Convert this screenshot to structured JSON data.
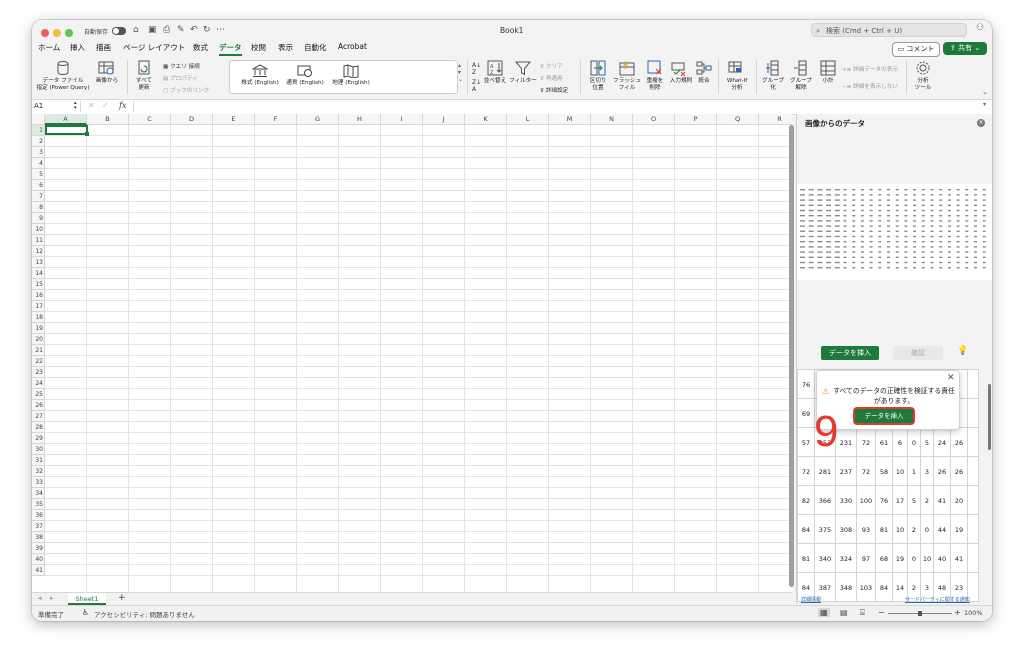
{
  "window": {
    "title": "Book1",
    "autosave_label": "自動保存",
    "search_placeholder": "検索 (Cmd + Ctrl + U)"
  },
  "tabs": [
    "ホーム",
    "挿入",
    "描画",
    "ページ レイアウト",
    "数式",
    "データ",
    "校閲",
    "表示",
    "自動化",
    "Acrobat"
  ],
  "active_tab": "データ",
  "top_right": {
    "comment": "コメント",
    "share": "共有"
  },
  "ribbon": {
    "get_data": "データ ファイル\n指定 (Power Query)",
    "from_picture": "画像から",
    "refresh_all": "すべて\n更新",
    "queries": "クエリ",
    "connections": "接続",
    "properties": "プロパティ",
    "workbook_links": "ブックのリンク",
    "stocks": "株式 (English)",
    "currencies": "通貨 (English)",
    "geography": "地理 (English)",
    "sort": "並べ替え",
    "filter": "フィルター",
    "clear": "クリア",
    "reapply": "再適用",
    "advanced": "詳細設定",
    "text_to_columns": "区切り\n位置",
    "flash_fill": "フラッシュ\nフィル",
    "remove_duplicates": "重複を\n削除",
    "data_validation": "入力規則",
    "consolidate": "統合",
    "what_if": "What-If\n分析",
    "group": "グループ\n化",
    "ungroup": "グループ\n解除",
    "subtotal": "小計",
    "show_detail": "詳細データの表示",
    "hide_detail": "詳細を表示しない",
    "analyze": "分析\nツール"
  },
  "formula_bar": {
    "name_box": "A1",
    "fx": "fx",
    "value": ""
  },
  "grid": {
    "columns": [
      "A",
      "B",
      "C",
      "D",
      "E",
      "F",
      "G",
      "H",
      "I",
      "J",
      "K",
      "L",
      "M",
      "N",
      "O",
      "P",
      "Q",
      "R"
    ],
    "rows": [
      "1",
      "2",
      "3",
      "4",
      "5",
      "6",
      "7",
      "8",
      "9",
      "10",
      "11",
      "12",
      "13",
      "14",
      "15",
      "16",
      "17",
      "18",
      "19",
      "20",
      "21",
      "22",
      "23",
      "24",
      "25",
      "26",
      "27",
      "28",
      "29",
      "30",
      "31",
      "32",
      "33",
      "34",
      "35",
      "36",
      "37",
      "38",
      "39",
      "40",
      "41"
    ]
  },
  "sheets": [
    "Sheet1"
  ],
  "add_sheet": "+",
  "status": {
    "ready": "準備完了",
    "accessibility": "アクセシビリティ: 問題ありません",
    "zoom": "100%"
  },
  "pane": {
    "title": "画像からのデータ",
    "insert_button": "データを挿入",
    "confirm_button": "確認",
    "tooltip_text": "すべてのデータの正確性を検証する責任があります。",
    "tooltip_insert": "データを挿入",
    "step_number": "9",
    "footer_left": "詳細情報",
    "footer_right": "サードパーティに関する通知",
    "table_rows": [
      [
        "76",
        "",
        "",
        "",
        "",
        "",
        "",
        "8",
        "31"
      ],
      [
        "69",
        "",
        "",
        "",
        "",
        "",
        "",
        "6",
        "31"
      ],
      [
        "57",
        "253",
        "231",
        "72",
        "61",
        "6",
        "0",
        "5",
        "24",
        "26"
      ],
      [
        "72",
        "281",
        "237",
        "72",
        "58",
        "10",
        "1",
        "3",
        "26",
        "26"
      ],
      [
        "82",
        "366",
        "330",
        "100",
        "76",
        "17",
        "5",
        "2",
        "41",
        "20"
      ],
      [
        "84",
        "375",
        "308",
        "93",
        "81",
        "10",
        "2",
        "0",
        "44",
        "19"
      ],
      [
        "81",
        "340",
        "324",
        "97",
        "68",
        "19",
        "0",
        "10",
        "40",
        "41"
      ],
      [
        "84",
        "387",
        "348",
        "103",
        "84",
        "14",
        "2",
        "3",
        "48",
        "23"
      ]
    ]
  }
}
